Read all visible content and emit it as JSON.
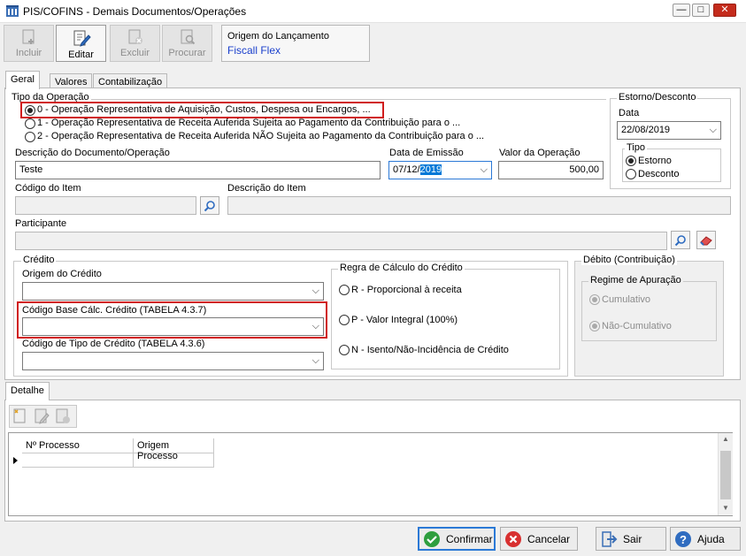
{
  "window": {
    "title": "PIS/COFINS - Demais Documentos/Operações"
  },
  "toolbar": {
    "incluir": "Incluir",
    "editar": "Editar",
    "excluir": "Excluir",
    "procurar": "Procurar"
  },
  "origem": {
    "label": "Origem do Lançamento",
    "value": "Fiscall Flex"
  },
  "tabs": {
    "geral": "Geral",
    "valores": "Valores",
    "contabilizacao": "Contabilização"
  },
  "tipo_operacao": {
    "label": "Tipo da Operação",
    "options": [
      "0 - Operação Representativa de Aquisição, Custos, Despesa ou Encargos, ...",
      "1 - Operação Representativa de Receita Auferida Sujeita ao Pagamento da Contribuição para o ...",
      "2 - Operação Representativa de Receita Auferida NÃO Sujeita ao Pagamento da Contribuição para o ..."
    ]
  },
  "estorno": {
    "label": "Estorno/Desconto",
    "data_label": "Data",
    "data_value": "22/08/2019",
    "tipo_label": "Tipo",
    "estorno": "Estorno",
    "desconto": "Desconto"
  },
  "descricao": {
    "label": "Descrição do Documento/Operação",
    "value": "Teste"
  },
  "emissao": {
    "label": "Data de Emissão",
    "prefix": "07/12/",
    "selected": "2019"
  },
  "valor": {
    "label": "Valor da Operação",
    "value": "500,00"
  },
  "item": {
    "codigo_label": "Código do Item",
    "descricao_label": "Descrição do Item"
  },
  "participante": {
    "label": "Participante"
  },
  "credito": {
    "label": "Crédito",
    "origem_label": "Origem do Crédito",
    "base_label": "Código Base Cálc. Crédito (TABELA 4.3.7)",
    "tipo_label": "Código de Tipo de Crédito (TABELA 4.3.6)",
    "regra_label": "Regra de Cálculo do Crédito",
    "regra_r": "R - Proporcional à receita",
    "regra_p": "P - Valor Integral (100%)",
    "regra_n": "N - Isento/Não-Incidência de Crédito"
  },
  "debito": {
    "label": "Débito (Contribuição)",
    "regime_label": "Regime de Apuração",
    "cumulativo": "Cumulativo",
    "nao_cumulativo": "Não-Cumulativo"
  },
  "detalhe": {
    "tab": "Detalhe",
    "col_processo": "Nº Processo",
    "col_origem": "Origem Processo"
  },
  "buttons": {
    "confirmar": "Confirmar",
    "cancelar": "Cancelar",
    "sair": "Sair",
    "ajuda": "Ajuda"
  }
}
